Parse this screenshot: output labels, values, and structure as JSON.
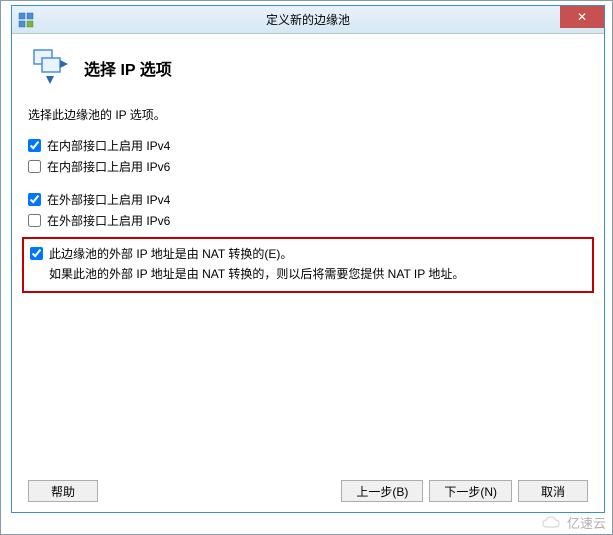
{
  "window": {
    "title": "定义新的边缘池",
    "close_glyph": "✕"
  },
  "header": {
    "title": "选择 IP 选项"
  },
  "intro": "选择此边缘池的 IP 选项。",
  "checkboxes": {
    "internal_ipv4": {
      "label": "在内部接口上启用 IPv4",
      "checked": true
    },
    "internal_ipv6": {
      "label": "在内部接口上启用 IPv6",
      "checked": false
    },
    "external_ipv4": {
      "label": "在外部接口上启用 IPv4",
      "checked": true
    },
    "external_ipv6": {
      "label": "在外部接口上启用 IPv6",
      "checked": false
    },
    "nat": {
      "label": "此边缘池的外部 IP 地址是由 NAT 转换的(E)。",
      "checked": true,
      "desc": "如果此池的外部 IP 地址是由 NAT 转换的，则以后将需要您提供 NAT IP 地址。"
    }
  },
  "buttons": {
    "help": "帮助",
    "back": "上一步(B)",
    "next": "下一步(N)",
    "cancel": "取消"
  },
  "watermark": "亿速云"
}
